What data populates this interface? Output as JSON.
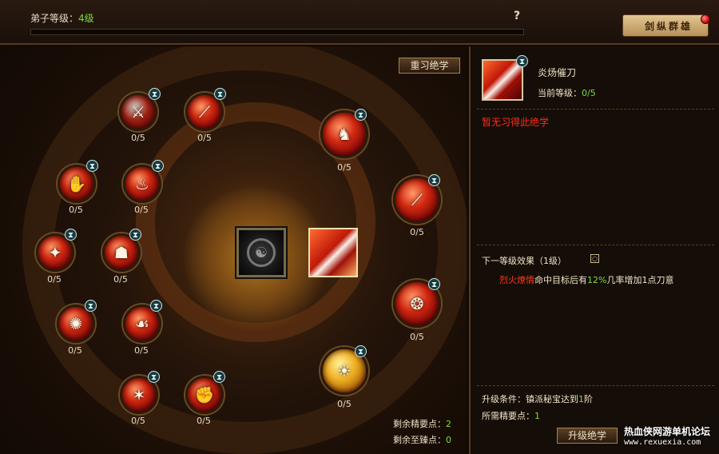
{
  "top": {
    "level_label": "弟子等级：",
    "level_value": "4级",
    "exp_fill_pct": 0,
    "help_symbol": "?",
    "logo_text": "剑纵群雄"
  },
  "left": {
    "reset_button": "重习绝学",
    "skills": [
      {
        "count": "0/5",
        "icon": "crossed-blades-icon"
      },
      {
        "count": "0/5",
        "icon": "red-slash-icon"
      },
      {
        "count": "0/5",
        "icon": "fire-palm-icon"
      },
      {
        "count": "0/5",
        "icon": "flame-icon"
      },
      {
        "count": "0/5",
        "icon": "dark-bird-icon"
      },
      {
        "count": "0/5",
        "icon": "warrior-stance-icon"
      },
      {
        "count": "0/5",
        "icon": "spiral-fire-icon"
      },
      {
        "count": "0/5",
        "icon": "kneeling-warrior-icon"
      },
      {
        "count": "0/5",
        "icon": "burst-icon"
      },
      {
        "count": "0/5",
        "icon": "fist-icon"
      },
      {
        "count": "0/5",
        "icon": "hero-silhouette-icon"
      },
      {
        "count": "0/5",
        "icon": "blade-streak-icon"
      },
      {
        "count": "0/5",
        "icon": "fire-pillar-icon"
      },
      {
        "count": "0/5",
        "icon": "golden-rays-icon"
      }
    ],
    "remain_points_label": "剩余精要点：",
    "remain_points_value": "2",
    "remain_extreme_label": "剩余至臻点：",
    "remain_extreme_value": "0"
  },
  "right": {
    "skill_name": "炎炀催刀",
    "current_level_label": "当前等级：",
    "current_level_value": "0/5",
    "not_learned": "暂无习得此绝学",
    "next_effect_title": "下一等级效果（1级）",
    "next_desc_red": "烈火燎情",
    "next_desc_mid": "命中目标后有",
    "next_desc_pct": "12%",
    "next_desc_tail": "几率增加1点刀意",
    "cond_label": "升级条件：镇派秘宝达到",
    "cond_value": "1",
    "cond_tail": "阶",
    "need_label": "所需精要点：",
    "need_value": "1",
    "upgrade_button": "升级绝学",
    "watermark_cn": "热血侠网游单机论坛",
    "watermark_url": "www.rexuexia.com"
  }
}
